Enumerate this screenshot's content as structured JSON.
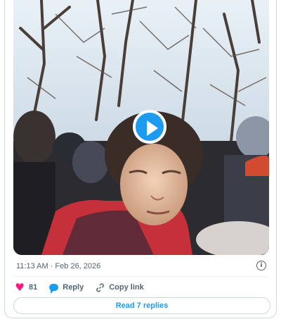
{
  "tweet": {
    "timestamp": "11:13 AM · Feb 26, 2026",
    "like_count": "81",
    "reply_label": "Reply",
    "copy_link_label": "Copy link",
    "read_replies_label": "Read 7 replies",
    "info_glyph": "i"
  },
  "icons": {
    "like": "heart-icon",
    "reply": "speech-bubble-icon",
    "copy": "link-icon",
    "play": "play-icon",
    "info": "info-icon"
  },
  "colors": {
    "accent": "#1d9bf0",
    "like": "#f91880",
    "muted": "#536471"
  }
}
